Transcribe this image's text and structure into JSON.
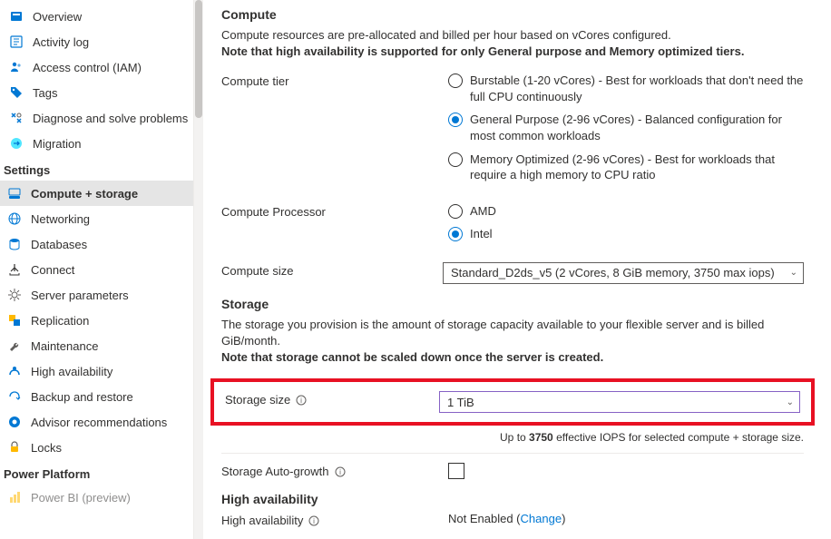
{
  "sidebar": {
    "top": [
      {
        "label": "Overview"
      },
      {
        "label": "Activity log"
      },
      {
        "label": "Access control (IAM)"
      },
      {
        "label": "Tags"
      },
      {
        "label": "Diagnose and solve problems"
      },
      {
        "label": "Migration"
      }
    ],
    "settingsHeader": "Settings",
    "settings": [
      {
        "label": "Compute + storage"
      },
      {
        "label": "Networking"
      },
      {
        "label": "Databases"
      },
      {
        "label": "Connect"
      },
      {
        "label": "Server parameters"
      },
      {
        "label": "Replication"
      },
      {
        "label": "Maintenance"
      },
      {
        "label": "High availability"
      },
      {
        "label": "Backup and restore"
      },
      {
        "label": "Advisor recommendations"
      },
      {
        "label": "Locks"
      }
    ],
    "powerHeader": "Power Platform",
    "power": [
      {
        "label": "Power BI (preview)"
      }
    ]
  },
  "compute": {
    "heading": "Compute",
    "note1": "Compute resources are pre-allocated and billed per hour based on vCores configured.",
    "note2": "Note that high availability is supported for only General purpose and Memory optimized tiers.",
    "tierLabel": "Compute tier",
    "tiers": {
      "burstable": "Burstable (1-20 vCores) - Best for workloads that don't need the full CPU continuously",
      "general": "General Purpose (2-96 vCores) - Balanced configuration for most common workloads",
      "memory": "Memory Optimized (2-96 vCores) - Best for workloads that require a high memory to CPU ratio"
    },
    "processorLabel": "Compute Processor",
    "processors": {
      "amd": "AMD",
      "intel": "Intel"
    },
    "sizeLabel": "Compute size",
    "sizeValue": "Standard_D2ds_v5 (2 vCores, 8 GiB memory, 3750 max iops)"
  },
  "storage": {
    "heading": "Storage",
    "note1": "The storage you provision is the amount of storage capacity available to your flexible server and is billed GiB/month.",
    "note2": "Note that storage cannot be scaled down once the server is created.",
    "sizeLabel": "Storage size",
    "sizeValue": "1 TiB",
    "iopsPrefix": "Up to ",
    "iopsValue": "3750",
    "iopsSuffix": " effective IOPS for selected compute + storage size.",
    "autoGrowthLabel": "Storage Auto-growth"
  },
  "ha": {
    "heading": "High availability",
    "label": "High availability",
    "status": "Not Enabled",
    "changeLabel": "Change"
  }
}
